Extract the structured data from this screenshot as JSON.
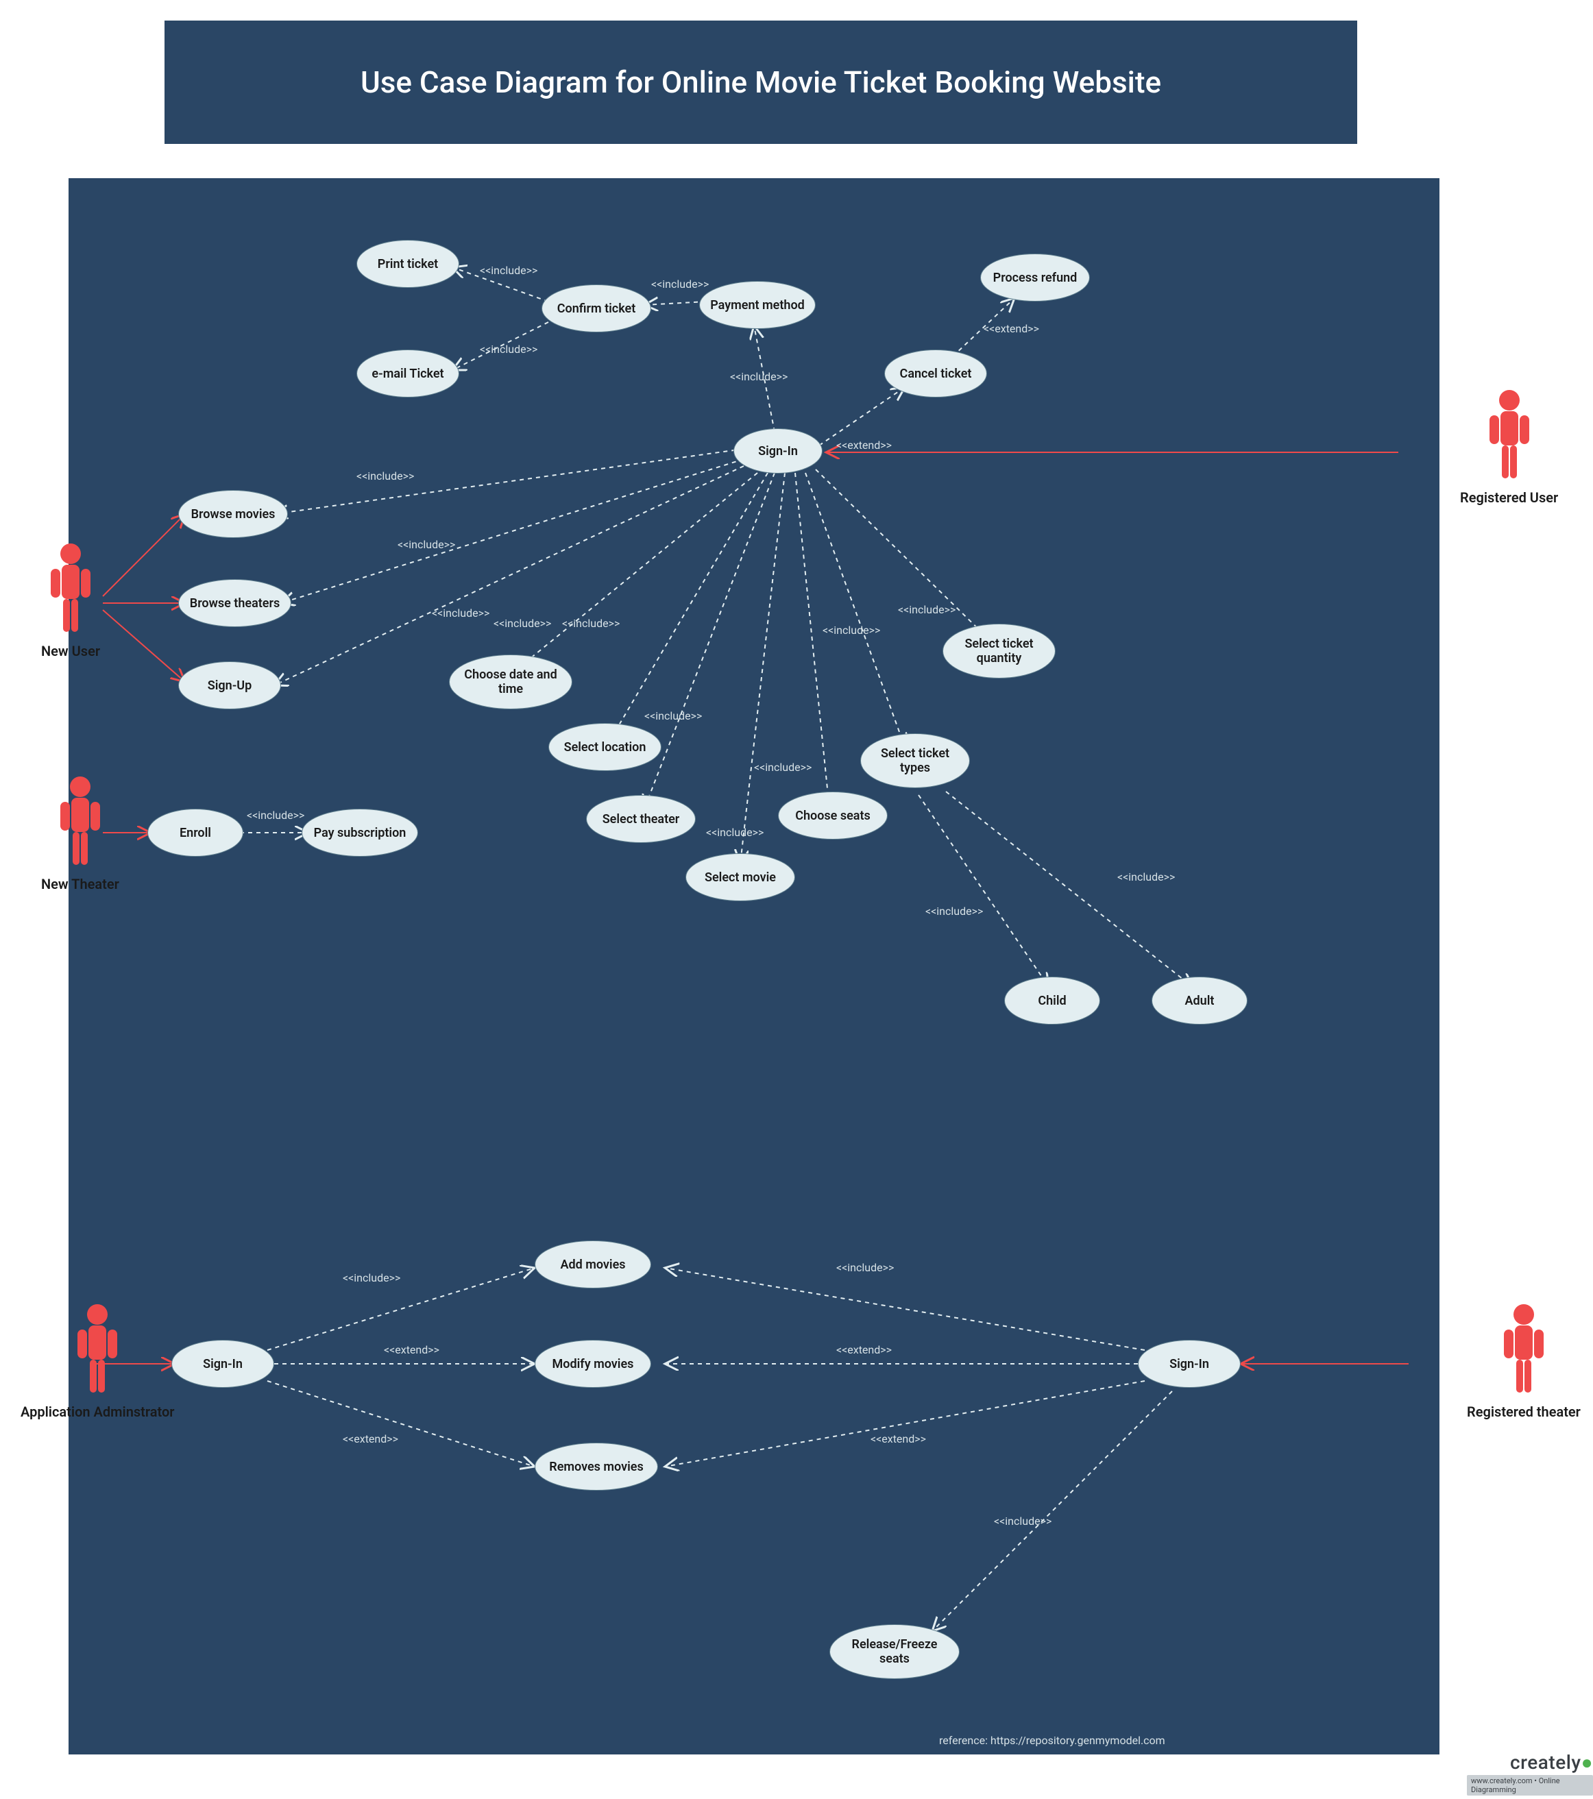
{
  "title": "Use Case Diagram for Online Movie Ticket Booking Website",
  "actors": {
    "new_user": "New User",
    "registered_user": "Registered User",
    "new_theater": "New Theater",
    "app_admin": "Application Adminstrator",
    "registered_theater": "Registered theater"
  },
  "nodes": {
    "print_ticket": "Print ticket",
    "confirm_ticket": "Confirm ticket",
    "payment_method": "Payment method",
    "process_refund": "Process refund",
    "email_ticket": "e-mail Ticket",
    "cancel_ticket": "Cancel ticket",
    "sign_in_top": "Sign-In",
    "browse_movies": "Browse movies",
    "browse_theaters": "Browse theaters",
    "sign_up": "Sign-Up",
    "choose_date_time": "Choose date and\ntime",
    "select_location": "Select location",
    "select_theater": "Select theater",
    "select_movie": "Select movie",
    "choose_seats": "Choose seats",
    "select_ticket_types": "Select ticket\ntypes",
    "select_ticket_qty": "Select ticket\nquantity",
    "enroll": "Enroll",
    "pay_subscription": "Pay subscription",
    "child": "Child",
    "adult": "Adult",
    "add_movies": "Add movies",
    "modify_movies": "Modify movies",
    "removes_movies": "Removes movies",
    "sign_in_left": "Sign-In",
    "sign_in_right": "Sign-In",
    "release_freeze": "Release/Freeze\nseats"
  },
  "labels": {
    "include": "<<include>>",
    "extend": "<<extend>>"
  },
  "reference": "reference: https://repository.genmymodel.com",
  "brand": {
    "name": "creately",
    "tagline": "www.creately.com • Online Diagramming"
  }
}
